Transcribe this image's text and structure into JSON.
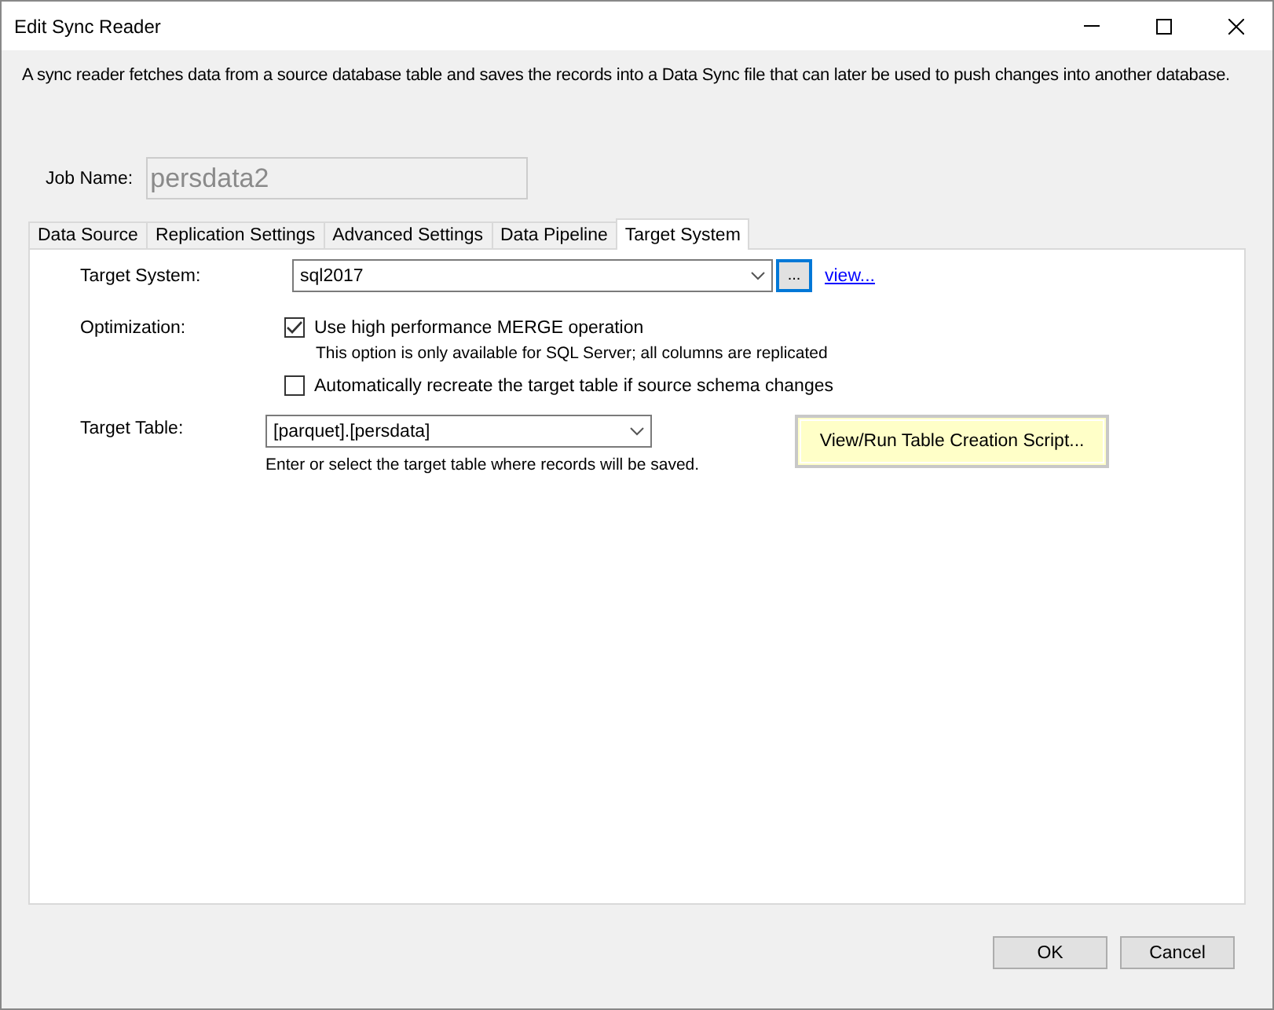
{
  "window": {
    "title": "Edit Sync Reader"
  },
  "description": "A sync reader fetches data from a source database table and saves the records into a Data Sync file that can later be used to push changes into another database.",
  "job_name": {
    "label": "Job Name:",
    "value": "persdata2",
    "disabled": true
  },
  "tabs": [
    {
      "label": "Data Source",
      "selected": false
    },
    {
      "label": "Replication Settings",
      "selected": false
    },
    {
      "label": "Advanced Settings",
      "selected": false
    },
    {
      "label": "Data Pipeline",
      "selected": false
    },
    {
      "label": "Target System",
      "selected": true
    }
  ],
  "target_system": {
    "label": "Target System:",
    "value": "sql2017",
    "browse_button": "...",
    "link": "view..."
  },
  "optimization": {
    "label": "Optimization:",
    "options": [
      {
        "label": "Use high performance MERGE operation",
        "checked": true,
        "note": "This option is only available for SQL Server; all columns are replicated"
      },
      {
        "label": "Automatically recreate the target table if source schema changes",
        "checked": false
      }
    ]
  },
  "target_table": {
    "label": "Target Table:",
    "value": "[parquet].[persdata]",
    "hint": "Enter or select the target table where records will be saved.",
    "script_button": "View/Run Table Creation Script..."
  },
  "buttons": [
    "OK",
    "Cancel"
  ]
}
